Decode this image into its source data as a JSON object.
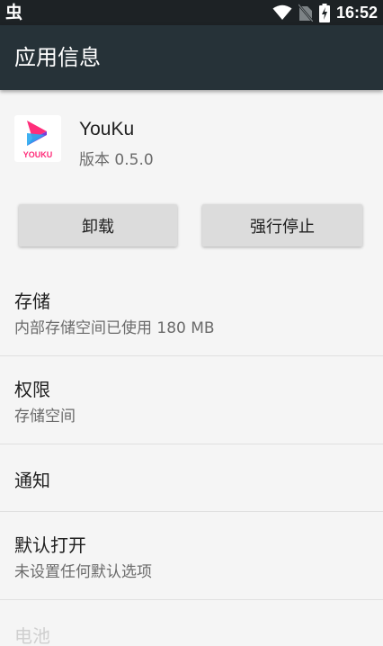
{
  "status_bar": {
    "left_glyph": "虫",
    "time": "16:52",
    "icons": [
      "wifi-icon",
      "no-sim-icon",
      "battery-charging-icon"
    ]
  },
  "app_bar": {
    "title": "应用信息"
  },
  "app": {
    "icon": "youku-logo",
    "logo_text": "YOUKU",
    "name": "YouKu",
    "version": "版本 0.5.0"
  },
  "buttons": {
    "uninstall": "卸载",
    "force_stop": "强行停止"
  },
  "settings": [
    {
      "title": "存储",
      "summary": "内部存储空间已使用 180 MB"
    },
    {
      "title": "权限",
      "summary": "存储空间"
    },
    {
      "title": "通知",
      "summary": ""
    },
    {
      "title": "默认打开",
      "summary": "未设置任何默认选项"
    },
    {
      "title": "电池",
      "summary": ""
    }
  ],
  "colors": {
    "status_bar": "#1d2225",
    "app_bar": "#263238",
    "background": "#f5f5f5",
    "button": "#dcdcdc",
    "logo_pink": "#ff2d7a",
    "logo_blue": "#2aa8f0"
  }
}
